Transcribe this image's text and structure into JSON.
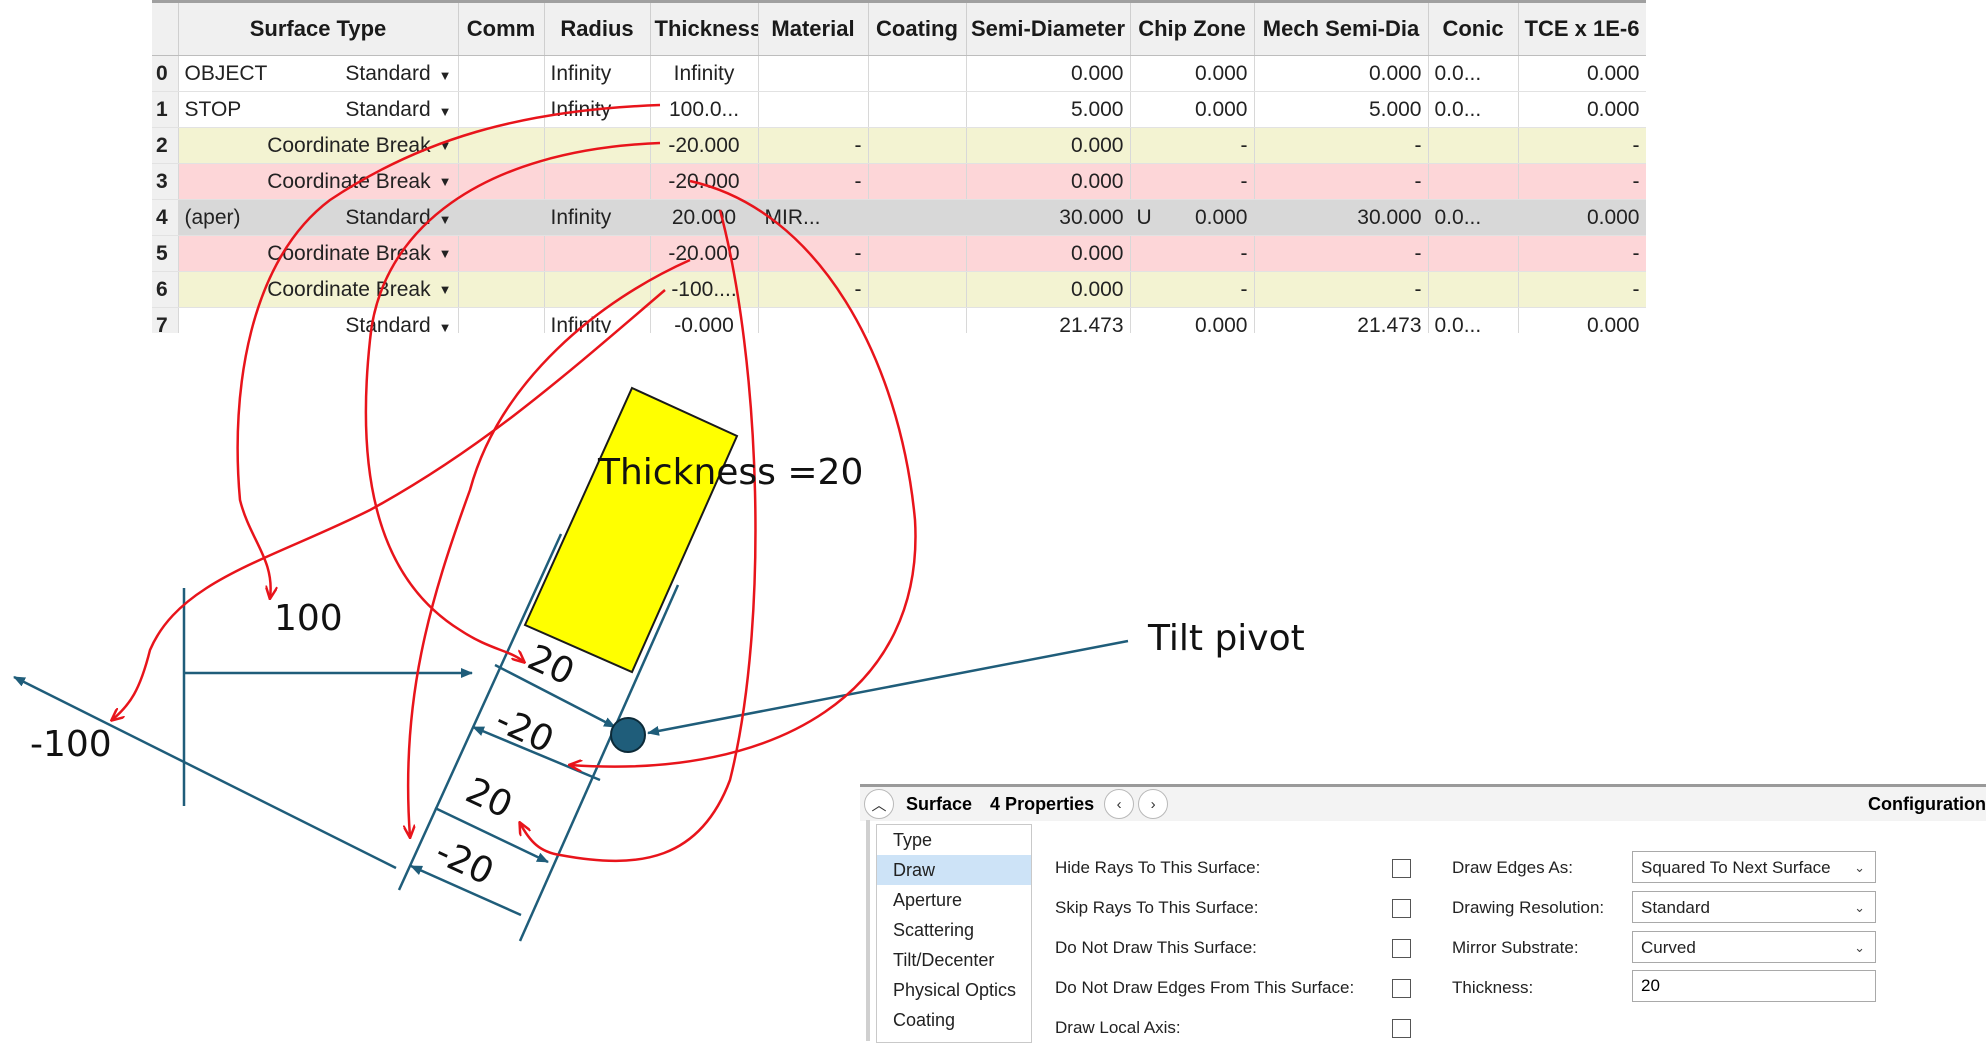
{
  "lde": {
    "columns": [
      "Surface Type",
      "Comm",
      "Radius",
      "Thickness",
      "Material",
      "Coating",
      "Semi-Diameter",
      "Chip Zone",
      "Mech Semi-Dia",
      "Conic",
      "TCE x 1E-6"
    ],
    "rows": [
      {
        "num": "0",
        "comment": "OBJECT",
        "type": "Standard",
        "radius": "Infinity",
        "thickness": "Infinity",
        "material": "",
        "semi": "0.000",
        "semi_flag": "",
        "chip": "0.000",
        "mech": "0.000",
        "conic": "0.0...",
        "tce": "0.000"
      },
      {
        "num": "1",
        "comment": "STOP",
        "type": "Standard",
        "radius": "Infinity",
        "thickness": "100.0...",
        "material": "",
        "semi": "5.000",
        "semi_flag": "",
        "chip": "0.000",
        "mech": "5.000",
        "conic": "0.0...",
        "tce": "0.000"
      },
      {
        "num": "2",
        "comment": "",
        "type": "Coordinate Break",
        "radius": "",
        "thickness": "-20.000",
        "material": "-",
        "semi": "0.000",
        "semi_flag": "",
        "chip": "-",
        "mech": "-",
        "conic": "",
        "tce": "-"
      },
      {
        "num": "3",
        "comment": "",
        "type": "Coordinate Break",
        "radius": "",
        "thickness": "-20.000",
        "material": "-",
        "semi": "0.000",
        "semi_flag": "",
        "chip": "-",
        "mech": "-",
        "conic": "",
        "tce": "-"
      },
      {
        "num": "4",
        "comment": "(aper)",
        "type": "Standard",
        "radius": "Infinity",
        "thickness": "20.000",
        "material": "MIR...",
        "semi": "30.000",
        "semi_flag": "U",
        "chip": "0.000",
        "mech": "30.000",
        "conic": "0.0...",
        "tce": "0.000"
      },
      {
        "num": "5",
        "comment": "",
        "type": "Coordinate Break",
        "radius": "",
        "thickness": "-20.000",
        "material": "-",
        "semi": "0.000",
        "semi_flag": "",
        "chip": "-",
        "mech": "-",
        "conic": "",
        "tce": "-"
      },
      {
        "num": "6",
        "comment": "",
        "type": "Coordinate Break",
        "radius": "",
        "thickness": "-100....",
        "material": "-",
        "semi": "0.000",
        "semi_flag": "",
        "chip": "-",
        "mech": "-",
        "conic": "",
        "tce": "-"
      },
      {
        "num": "7",
        "comment": "",
        "type": "Standard",
        "radius": "Infinity",
        "thickness": "-0.000",
        "material": "",
        "semi": "21.473",
        "semi_flag": "",
        "chip": "0.000",
        "mech": "21.473",
        "conic": "0.0...",
        "tce": "0.000"
      }
    ]
  },
  "diagram": {
    "thickness_label": "Thickness =20",
    "label_100": "100",
    "label_neg100": "-100",
    "label_20_a": "20",
    "label_neg20_a": "-20",
    "label_20_b": "20",
    "label_neg20_b": "-20",
    "tilt_pivot_label": "Tilt pivot",
    "mirror_color": "#ffff00",
    "line_color": "#1f5d7a",
    "annotation_color": "#e8141b"
  },
  "props": {
    "title": "Surface",
    "count": "4 Properties",
    "config": "Configuration",
    "sidebar": [
      "Type",
      "Draw",
      "Aperture",
      "Scattering",
      "Tilt/Decenter",
      "Physical Optics",
      "Coating"
    ],
    "active_item": "Draw",
    "checks": [
      "Hide Rays To This Surface:",
      "Skip Rays To This Surface:",
      "Do Not Draw This Surface:",
      "Do Not Draw Edges From This Surface:",
      "Draw Local Axis:"
    ],
    "draw_edges_label": "Draw Edges As:",
    "draw_edges_value": "Squared To Next Surface",
    "drawing_resolution_label": "Drawing Resolution:",
    "drawing_resolution_value": "Standard",
    "mirror_substrate_label": "Mirror Substrate:",
    "mirror_substrate_value": "Curved",
    "thickness_label": "Thickness:",
    "thickness_value": "20"
  }
}
